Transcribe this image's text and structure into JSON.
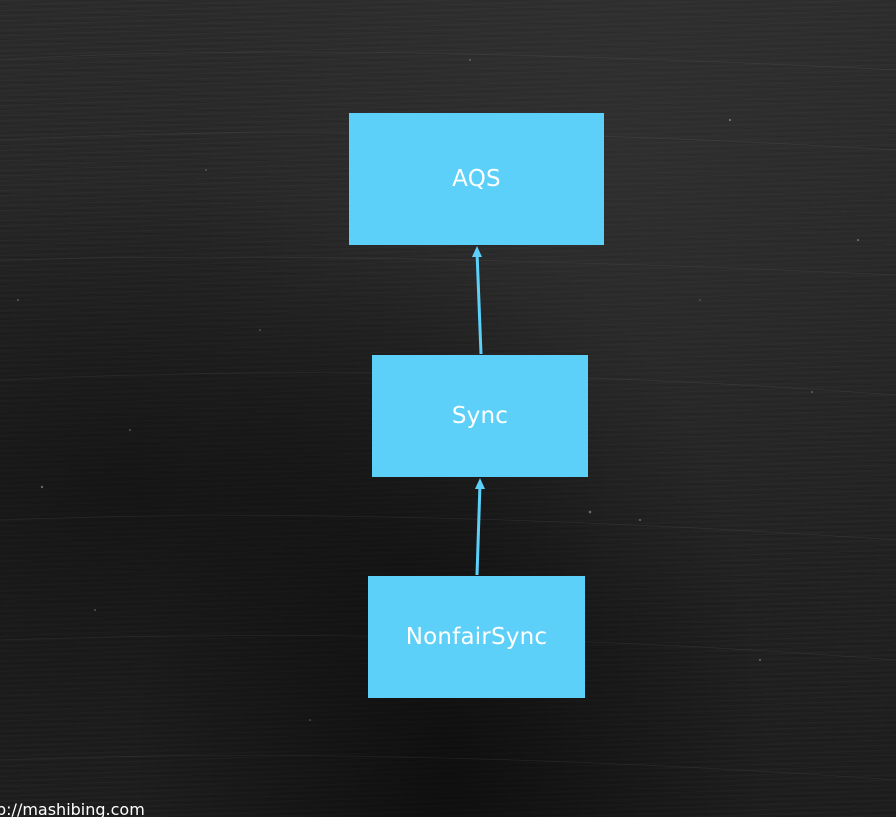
{
  "diagram": {
    "nodes": [
      {
        "id": "aqs",
        "label": "AQS"
      },
      {
        "id": "sync",
        "label": "Sync"
      },
      {
        "id": "nonfair",
        "label": "NonfairSync"
      }
    ],
    "edges": [
      {
        "from": "sync",
        "to": "aqs"
      },
      {
        "from": "nonfair",
        "to": "sync"
      }
    ],
    "colors": {
      "node_fill": "#5dd0fa",
      "node_text": "#ffffff",
      "edge": "#5dd0fa",
      "background": "#242424"
    }
  },
  "watermark": {
    "text": "p://mashibing.com"
  }
}
